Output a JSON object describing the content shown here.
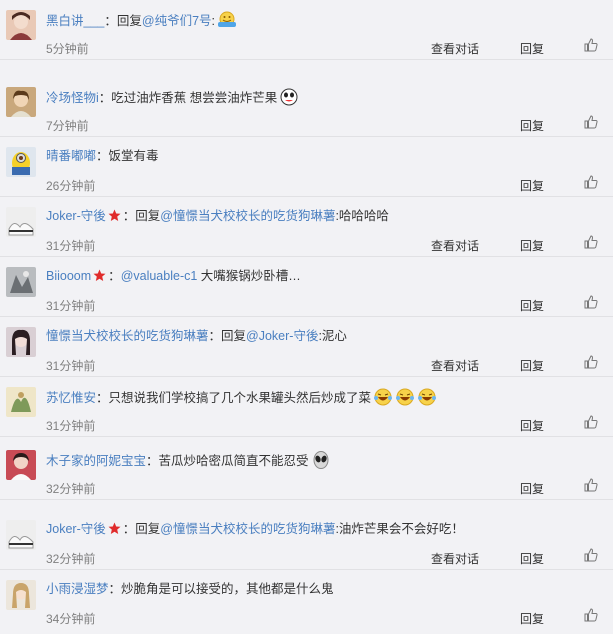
{
  "comments": [
    {
      "user": "黑白讲___",
      "star": false,
      "parts": [
        {
          "t": "：回复",
          "c": "txt"
        },
        {
          "t": "@纯爷们7号",
          "c": "at"
        },
        {
          "t": ":",
          "c": "txt"
        }
      ],
      "emoji": [
        "hug"
      ],
      "time": "5分钟前",
      "view_dialog": "查看对话",
      "reply": "回复"
    },
    {
      "user": "冷场怪物i",
      "star": false,
      "parts": [
        {
          "t": "：吃过油炸香蕉 想尝尝油炸芒果",
          "c": "txt"
        }
      ],
      "emoji": [
        "cheeky"
      ],
      "time": "7分钟前",
      "view_dialog": "",
      "reply": "回复"
    },
    {
      "user": "晴番嘟嘟",
      "star": false,
      "parts": [
        {
          "t": "：饭堂有毒",
          "c": "txt"
        }
      ],
      "emoji": [],
      "time": "26分钟前",
      "view_dialog": "",
      "reply": "回复"
    },
    {
      "user": "Joker-守後",
      "star": true,
      "parts": [
        {
          "t": "：回复",
          "c": "txt"
        },
        {
          "t": "@憧憬当犬校校长的吃货狗琳薯",
          "c": "at"
        },
        {
          "t": ":哈哈哈哈",
          "c": "txt"
        }
      ],
      "emoji": [],
      "time": "31分钟前",
      "view_dialog": "查看对话",
      "reply": "回复"
    },
    {
      "user": "Biiooom",
      "star": true,
      "parts": [
        {
          "t": "：",
          "c": "txt"
        },
        {
          "t": "@valuable-c1",
          "c": "at"
        },
        {
          "t": " 大嘴猴锅炒卧槽…",
          "c": "txt"
        }
      ],
      "emoji": [],
      "time": "31分钟前",
      "view_dialog": "",
      "reply": "回复"
    },
    {
      "user": "憧憬当犬校校长的吃货狗琳薯",
      "star": false,
      "parts": [
        {
          "t": "：回复",
          "c": "txt"
        },
        {
          "t": "@Joker-守後",
          "c": "at"
        },
        {
          "t": ":泥心",
          "c": "txt"
        }
      ],
      "emoji": [],
      "time": "31分钟前",
      "view_dialog": "查看对话",
      "reply": "回复"
    },
    {
      "user": "苏忆惟安",
      "star": false,
      "parts": [
        {
          "t": "：只想说我们学校搞了几个水果罐头然后炒成了菜",
          "c": "txt"
        }
      ],
      "emoji": [
        "laugh",
        "laugh",
        "laugh"
      ],
      "time": "31分钟前",
      "view_dialog": "",
      "reply": "回复"
    },
    {
      "user": "木子家的阿妮宝宝",
      "star": false,
      "parts": [
        {
          "t": "：苦瓜炒哈密瓜简直不能忍受",
          "c": "txt"
        }
      ],
      "emoji": [
        "alien"
      ],
      "time": "32分钟前",
      "view_dialog": "",
      "reply": "回复"
    },
    {
      "user": "Joker-守後",
      "star": true,
      "parts": [
        {
          "t": "：回复",
          "c": "txt"
        },
        {
          "t": "@憧憬当犬校校长的吃货狗琳薯",
          "c": "at"
        },
        {
          "t": ":油炸芒果会不会好吃！",
          "c": "txt"
        }
      ],
      "emoji": [],
      "time": "32分钟前",
      "view_dialog": "查看对话",
      "reply": "回复"
    },
    {
      "user": "小雨浸湿梦",
      "star": false,
      "parts": [
        {
          "t": "：炒脆角是可以接受的，其他都是什么鬼",
          "c": "txt"
        }
      ],
      "emoji": [],
      "time": "34分钟前",
      "view_dialog": "",
      "reply": "回复"
    }
  ],
  "icons": {
    "like": "thumbs-up-icon",
    "star": "star-icon"
  },
  "colors": {
    "username": "#4a7fc0",
    "background": "#f2f2f5",
    "star": "#e02b2b",
    "time": "#808080"
  }
}
